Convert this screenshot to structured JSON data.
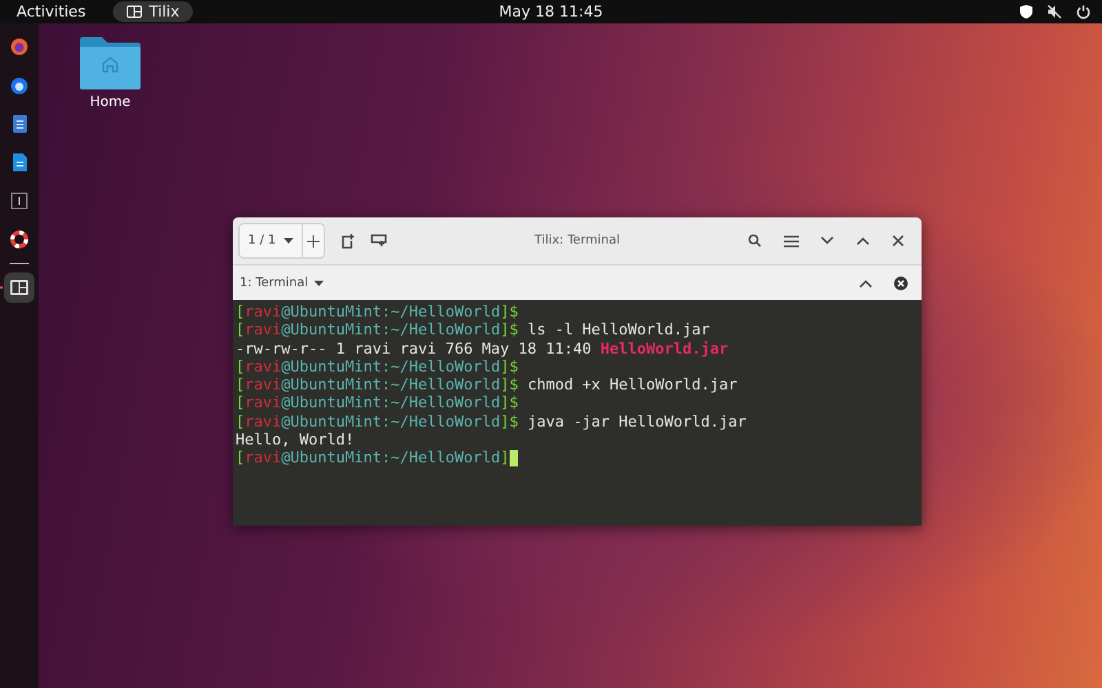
{
  "top_bar": {
    "activities": "Activities",
    "app": "Tilix",
    "clock": "May 18  11:45"
  },
  "dock": [
    {
      "kind": "browser",
      "selected": false
    },
    {
      "kind": "mail",
      "selected": false
    },
    {
      "kind": "editor",
      "selected": false
    },
    {
      "kind": "document",
      "selected": false
    },
    {
      "kind": "panel",
      "selected": false
    },
    {
      "kind": "help",
      "selected": false
    },
    {
      "kind": "terminal",
      "selected": true
    }
  ],
  "desktop_icons": [
    {
      "label": "Home"
    }
  ],
  "window": {
    "session": "1 / 1",
    "title": "Tilix: Terminal",
    "terminal_title": "1: Terminal",
    "lines": [
      {
        "cursor": false,
        "segments": [
          {
            "kind": "bracket",
            "text": "["
          },
          {
            "kind": "user",
            "text": "ravi"
          },
          {
            "kind": "host",
            "text": "@UbuntuMint:~/HelloWorld"
          },
          {
            "kind": "bracket",
            "text": "]$"
          }
        ]
      },
      {
        "cursor": false,
        "segments": [
          {
            "kind": "bracket",
            "text": "["
          },
          {
            "kind": "user",
            "text": "ravi"
          },
          {
            "kind": "host",
            "text": "@UbuntuMint:~/HelloWorld"
          },
          {
            "kind": "bracket",
            "text": "]$"
          },
          {
            "kind": "plain",
            "text": " ls -l HelloWorld.jar"
          }
        ]
      },
      {
        "cursor": false,
        "segments": [
          {
            "kind": "plain",
            "text": "-rw-rw-r-- 1 ravi ravi 766 May 18 11:40 "
          },
          {
            "kind": "file",
            "text": "HelloWorld.jar"
          }
        ]
      },
      {
        "cursor": false,
        "segments": [
          {
            "kind": "bracket",
            "text": "["
          },
          {
            "kind": "user",
            "text": "ravi"
          },
          {
            "kind": "host",
            "text": "@UbuntuMint:~/HelloWorld"
          },
          {
            "kind": "bracket",
            "text": "]$"
          }
        ]
      },
      {
        "cursor": false,
        "segments": [
          {
            "kind": "bracket",
            "text": "["
          },
          {
            "kind": "user",
            "text": "ravi"
          },
          {
            "kind": "host",
            "text": "@UbuntuMint:~/HelloWorld"
          },
          {
            "kind": "bracket",
            "text": "]$"
          },
          {
            "kind": "plain",
            "text": " chmod +x HelloWorld.jar"
          }
        ]
      },
      {
        "cursor": false,
        "segments": [
          {
            "kind": "bracket",
            "text": "["
          },
          {
            "kind": "user",
            "text": "ravi"
          },
          {
            "kind": "host",
            "text": "@UbuntuMint:~/HelloWorld"
          },
          {
            "kind": "bracket",
            "text": "]$"
          }
        ]
      },
      {
        "cursor": false,
        "segments": [
          {
            "kind": "bracket",
            "text": "["
          },
          {
            "kind": "user",
            "text": "ravi"
          },
          {
            "kind": "host",
            "text": "@UbuntuMint:~/HelloWorld"
          },
          {
            "kind": "bracket",
            "text": "]$"
          },
          {
            "kind": "plain",
            "text": " java -jar HelloWorld.jar"
          }
        ]
      },
      {
        "cursor": false,
        "segments": [
          {
            "kind": "plain",
            "text": "Hello, World!"
          }
        ]
      },
      {
        "cursor": true,
        "segments": [
          {
            "kind": "bracket",
            "text": "["
          },
          {
            "kind": "user",
            "text": "ravi"
          },
          {
            "kind": "host",
            "text": "@UbuntuMint:~/HelloWorld"
          },
          {
            "kind": "bracket",
            "text": "]"
          }
        ]
      }
    ]
  }
}
